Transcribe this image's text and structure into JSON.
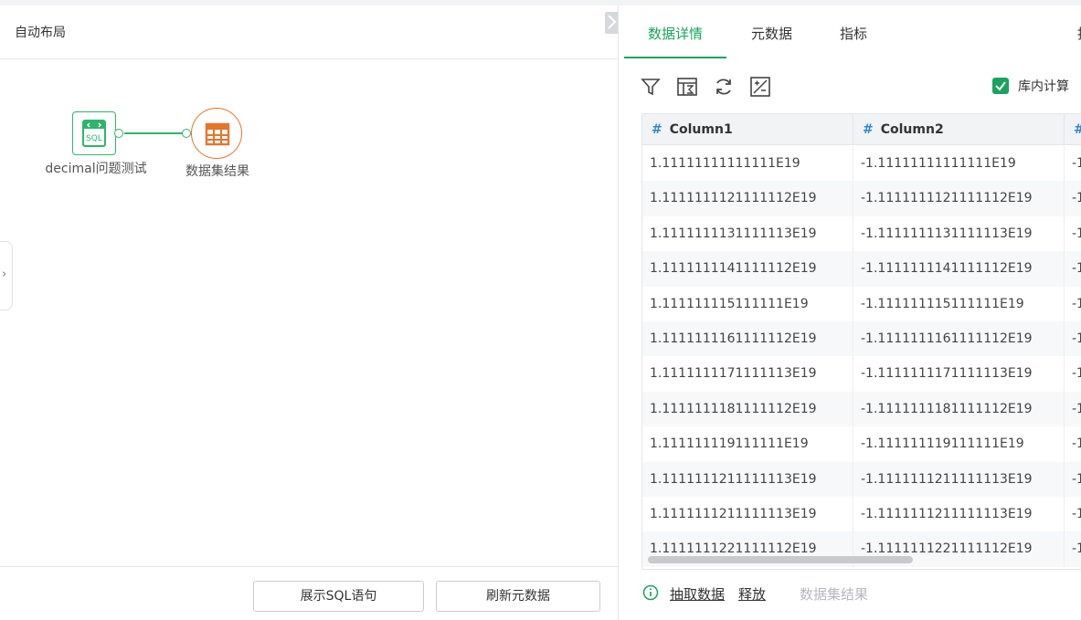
{
  "left": {
    "title": "自动布局",
    "nodes": {
      "sql_label": "decimal问题测试",
      "result_label": "数据集结果"
    },
    "footer": {
      "show_sql_label": "展示SQL语句",
      "refresh_meta_label": "刷新元数据"
    }
  },
  "right": {
    "tabs": [
      {
        "label": "数据详情",
        "active": true
      },
      {
        "label": "元数据",
        "active": false
      },
      {
        "label": "指标",
        "active": false
      }
    ],
    "tab_cut_label": "指",
    "toolbar": {
      "icons": [
        "filter-icon",
        "sort-icon",
        "refresh-icon",
        "calc-icon"
      ],
      "inside_calc_label": "库内计算",
      "inside_calc_checked": true
    },
    "table": {
      "columns": [
        "Column1",
        "Column2",
        ""
      ],
      "rows": [
        [
          "1.11111111111111E19",
          "-1.11111111111111E19",
          "-1"
        ],
        [
          "1.1111111121111112E19",
          "-1.1111111121111112E19",
          "-1"
        ],
        [
          "1.1111111131111113E19",
          "-1.1111111131111113E19",
          "-1"
        ],
        [
          "1.1111111141111112E19",
          "-1.1111111141111112E19",
          "-1"
        ],
        [
          "1.111111115111111E19",
          "-1.111111115111111E19",
          "-1"
        ],
        [
          "1.1111111161111112E19",
          "-1.1111111161111112E19",
          "-1"
        ],
        [
          "1.1111111171111113E19",
          "-1.1111111171111113E19",
          "-1"
        ],
        [
          "1.1111111181111112E19",
          "-1.1111111181111112E19",
          "-1"
        ],
        [
          "1.111111119111111E19",
          "-1.111111119111111E19",
          "-1"
        ],
        [
          "1.1111111211111113E19",
          "-1.1111111211111113E19",
          "-1"
        ],
        [
          "1.1111111211111113E19",
          "-1.1111111211111113E19",
          "-1"
        ],
        [
          "1.1111111221111112E19",
          "-1.1111111221111112E19",
          "-1"
        ]
      ]
    },
    "bottom": {
      "extract_label": "抽取数据",
      "release_label": "释放",
      "dataset_label": "数据集结果"
    }
  },
  "colors": {
    "accent": "#1aa35e",
    "orange": "#e8742a",
    "hash": "#2f8bcc"
  }
}
